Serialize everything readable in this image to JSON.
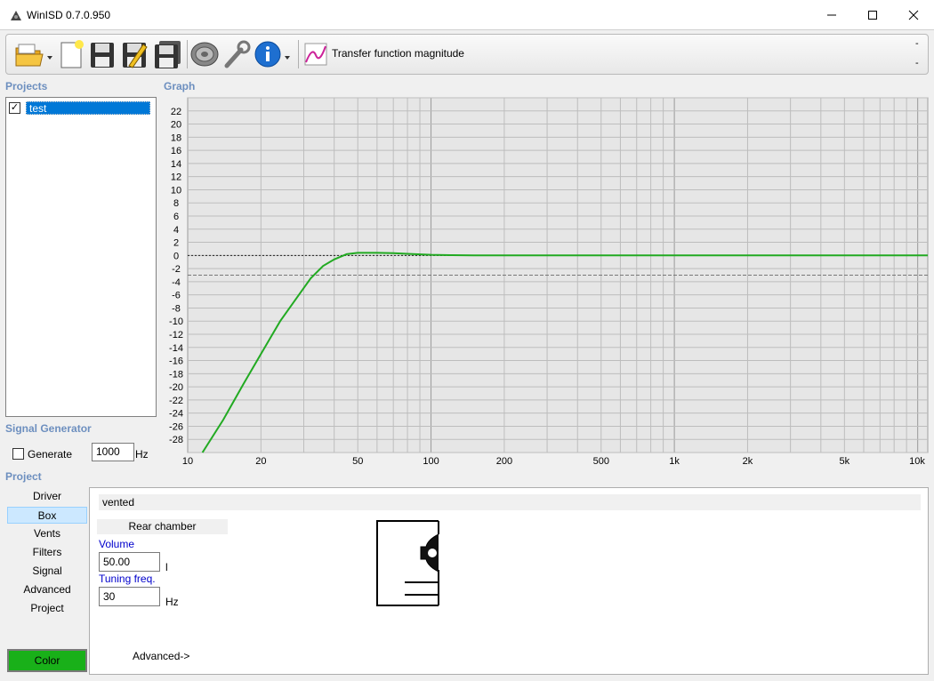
{
  "window": {
    "title": "WinISD 0.7.0.950",
    "minimize": "—",
    "maximize": "☐",
    "close": "✕"
  },
  "toolbar": {
    "icons": [
      "open-folder-icon",
      "new-project-icon",
      "save-icon",
      "save-as-icon",
      "save-all-icon",
      "driver-icon",
      "tools-icon",
      "info-icon",
      "graph-icon"
    ],
    "graph_selector_label": "Transfer function magnitude",
    "dash_top": "-",
    "dash_bottom": "-"
  },
  "projects": {
    "label": "Projects",
    "items": [
      {
        "name": "test",
        "checked": true
      }
    ]
  },
  "graph": {
    "label": "Graph"
  },
  "signal_generator": {
    "label": "Signal Generator",
    "generate_label": "Generate",
    "frequency": "1000",
    "unit": "Hz"
  },
  "project_section": {
    "label": "Project",
    "nav": [
      "Driver",
      "Box",
      "Vents",
      "Filters",
      "Signal",
      "Advanced",
      "Project"
    ],
    "active": "Box",
    "color_button": "Color"
  },
  "box": {
    "type": "vented",
    "rear_chamber_label": "Rear chamber",
    "volume_label": "Volume",
    "volume_value": "50.00",
    "volume_unit": "l",
    "tuning_label": "Tuning freq.",
    "tuning_value": "30",
    "tuning_unit": "Hz",
    "advanced_link": "Advanced->"
  },
  "colors": {
    "curve": "#22aa22",
    "selection": "#0078d7",
    "color_button": "#19b019",
    "section_label": "#6d8fbf"
  },
  "chart_data": {
    "type": "line",
    "title": "",
    "xlabel": "",
    "ylabel": "",
    "x_scale": "log",
    "xlim": [
      10,
      11000
    ],
    "ylim": [
      -30,
      24
    ],
    "x_ticks": [
      10,
      20,
      50,
      100,
      200,
      500,
      1000,
      2000,
      5000,
      10000
    ],
    "x_tick_labels": [
      "10",
      "20",
      "50",
      "100",
      "200",
      "500",
      "1k",
      "2k",
      "5k",
      "10k"
    ],
    "y_ticks": [
      22,
      20,
      18,
      16,
      14,
      12,
      10,
      8,
      6,
      4,
      2,
      0,
      -2,
      -4,
      -6,
      -8,
      -10,
      -12,
      -14,
      -16,
      -18,
      -20,
      -22,
      -24,
      -26,
      -28
    ],
    "grid": true,
    "reference_lines": [
      {
        "y": 0,
        "style": "dotted"
      },
      {
        "y": -3,
        "style": "dashed"
      }
    ],
    "series": [
      {
        "color": "#22aa22",
        "x": [
          11.5,
          14,
          17,
          20,
          24,
          28,
          32,
          36,
          40,
          45,
          50,
          60,
          70,
          80,
          100,
          120,
          150,
          200,
          500,
          1000,
          5000,
          11000
        ],
        "y": [
          -30,
          -25,
          -19.5,
          -15,
          -10,
          -6.5,
          -3.5,
          -1.6,
          -0.6,
          0.2,
          0.4,
          0.4,
          0.35,
          0.25,
          0.1,
          0.05,
          0.02,
          0,
          0,
          0,
          0,
          0
        ]
      }
    ]
  }
}
